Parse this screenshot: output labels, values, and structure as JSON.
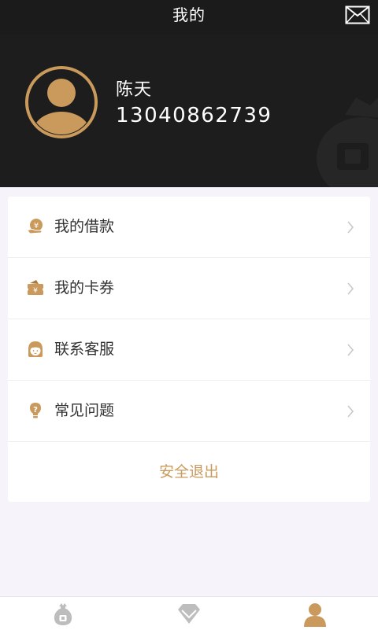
{
  "header": {
    "title": "我的",
    "mail_icon": "mail-icon"
  },
  "profile": {
    "name": "陈天",
    "phone": "13040862739",
    "avatar_icon": "user-avatar-icon"
  },
  "menu": {
    "items": [
      {
        "label": "我的借款",
        "icon": "loan-icon"
      },
      {
        "label": "我的卡券",
        "icon": "coupon-icon"
      },
      {
        "label": "联系客服",
        "icon": "customer-service-icon"
      },
      {
        "label": "常见问题",
        "icon": "question-icon"
      }
    ],
    "logout_label": "安全退出"
  },
  "tabs": [
    {
      "icon": "money-bag-icon",
      "active": false
    },
    {
      "icon": "diamond-icon",
      "active": false
    },
    {
      "icon": "person-icon",
      "active": true
    }
  ],
  "colors": {
    "accent": "#c99a5b",
    "header_bg": "#1b1b1b",
    "page_bg": "#f6f4fa",
    "inactive_tab": "#bdbdbd"
  }
}
